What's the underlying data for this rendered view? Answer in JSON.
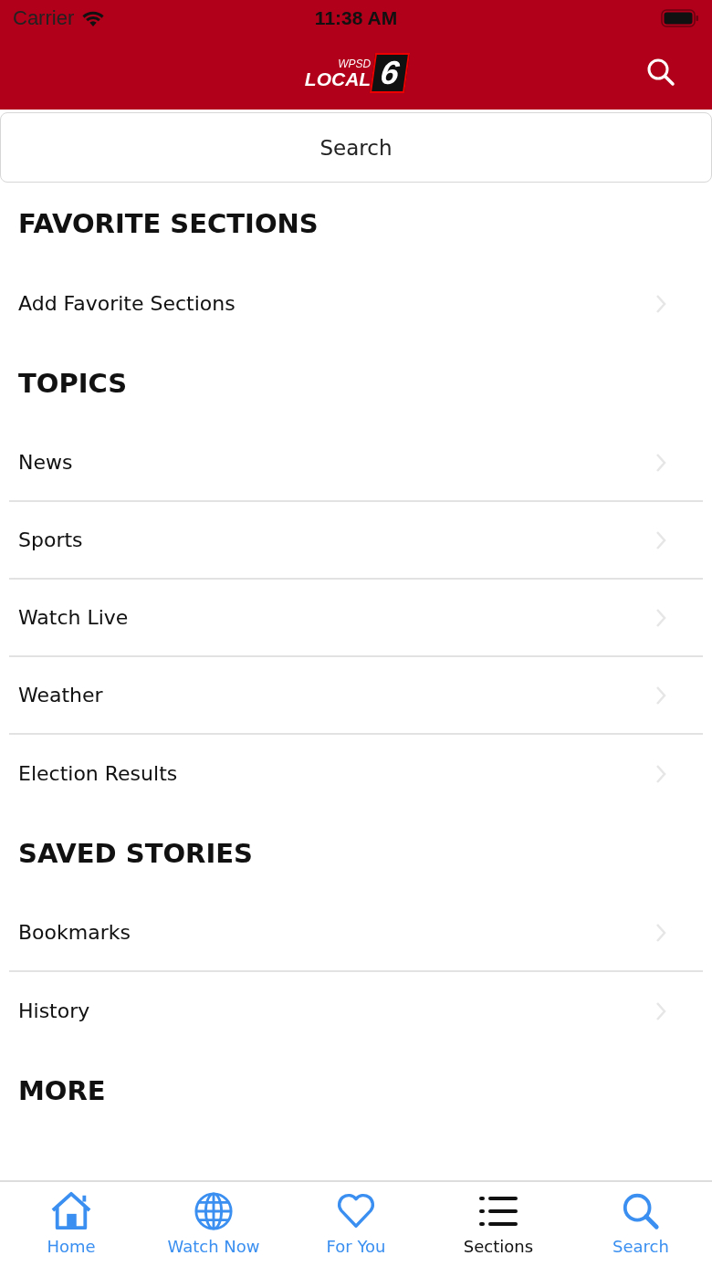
{
  "status_bar": {
    "carrier": "Carrier",
    "time": "11:38 AM"
  },
  "header": {
    "logo": {
      "small": "WPSD",
      "large": "LOCAL",
      "number": "6"
    }
  },
  "search": {
    "placeholder": "Search"
  },
  "sections": [
    {
      "title": "FAVORITE SECTIONS",
      "items": [
        "Add Favorite Sections"
      ]
    },
    {
      "title": "TOPICS",
      "items": [
        "News",
        "Sports",
        "Watch Live",
        "Weather",
        "Election Results"
      ]
    },
    {
      "title": "SAVED STORIES",
      "items": [
        "Bookmarks",
        "History"
      ]
    },
    {
      "title": "MORE"
    }
  ],
  "tab_bar": [
    {
      "label": "Home",
      "kind": "home",
      "selected": false
    },
    {
      "label": "Watch Now",
      "kind": "globe",
      "selected": false
    },
    {
      "label": "For You",
      "kind": "heart",
      "selected": false
    },
    {
      "label": "Sections",
      "kind": "list",
      "selected": true
    },
    {
      "label": "Search",
      "kind": "search",
      "selected": false
    }
  ]
}
